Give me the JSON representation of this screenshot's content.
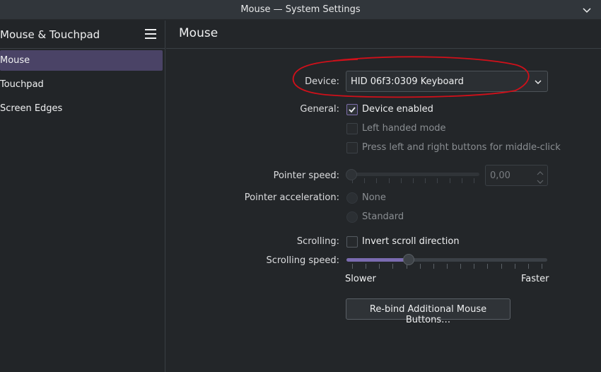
{
  "window": {
    "title": "Mouse — System Settings"
  },
  "sidebar": {
    "title": "Mouse & Touchpad",
    "items": [
      {
        "label": "Mouse",
        "active": true
      },
      {
        "label": "Touchpad",
        "active": false
      },
      {
        "label": "Screen Edges",
        "active": false
      }
    ]
  },
  "main": {
    "title": "Mouse",
    "device": {
      "label": "Device:",
      "value": "HID 06f3:0309 Keyboard"
    },
    "general": {
      "label": "General:",
      "options": [
        {
          "label": "Device enabled",
          "checked": true,
          "enabled": true
        },
        {
          "label": "Left handed mode",
          "checked": false,
          "enabled": false
        },
        {
          "label": "Press left and right buttons for middle-click",
          "checked": false,
          "enabled": false
        }
      ]
    },
    "pointer_speed": {
      "label": "Pointer speed:",
      "value": "0,00",
      "level": 0,
      "enabled": false
    },
    "pointer_acceleration": {
      "label": "Pointer acceleration:",
      "options": [
        {
          "label": "None",
          "selected": false,
          "enabled": false
        },
        {
          "label": "Standard",
          "selected": false,
          "enabled": false
        }
      ]
    },
    "scrolling": {
      "label": "Scrolling:",
      "invert_label": "Invert scroll direction",
      "invert_checked": false
    },
    "scrolling_speed": {
      "label": "Scrolling speed:",
      "min_label": "Slower",
      "max_label": "Faster",
      "level": 0.3
    },
    "rebind_button": "Re-bind Additional Mouse Buttons…"
  },
  "colors": {
    "accent": "#7a6bb0",
    "selection": "#4a4366",
    "annotation": "#d0101a"
  },
  "icons": {
    "titlebar": "chevron-down-icon",
    "sidebar_menu": "hamburger-icon",
    "combo": "chevron-down-icon",
    "check": "checkmark-icon"
  }
}
